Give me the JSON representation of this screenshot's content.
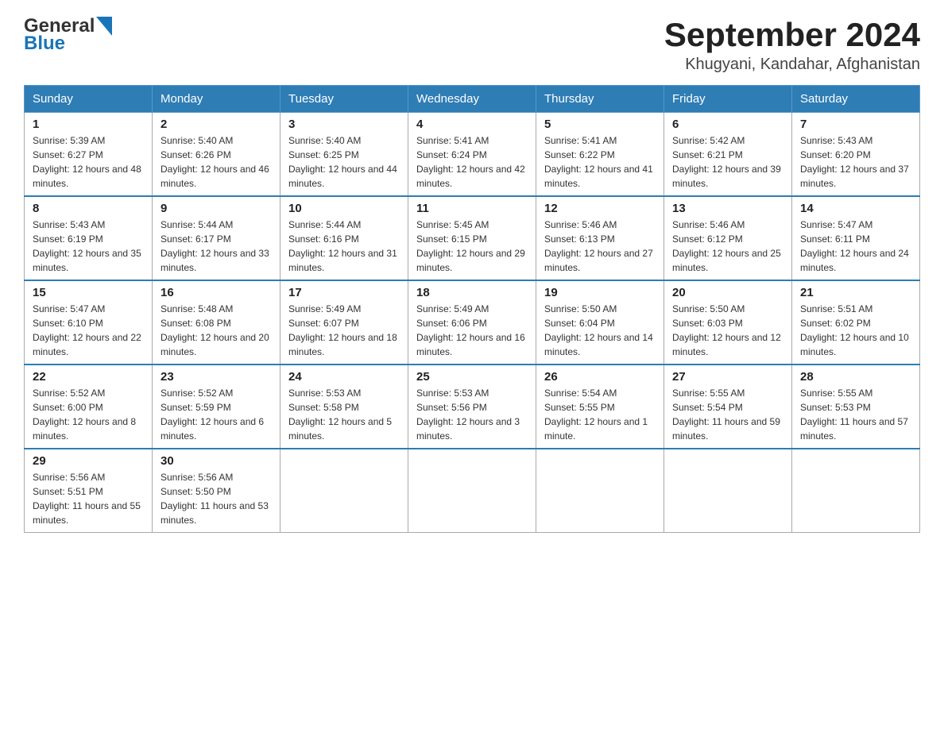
{
  "header": {
    "logo_general": "General",
    "logo_blue": "Blue",
    "title": "September 2024",
    "subtitle": "Khugyani, Kandahar, Afghanistan"
  },
  "columns": [
    "Sunday",
    "Monday",
    "Tuesday",
    "Wednesday",
    "Thursday",
    "Friday",
    "Saturday"
  ],
  "weeks": [
    [
      {
        "day": "1",
        "sunrise": "Sunrise: 5:39 AM",
        "sunset": "Sunset: 6:27 PM",
        "daylight": "Daylight: 12 hours and 48 minutes."
      },
      {
        "day": "2",
        "sunrise": "Sunrise: 5:40 AM",
        "sunset": "Sunset: 6:26 PM",
        "daylight": "Daylight: 12 hours and 46 minutes."
      },
      {
        "day": "3",
        "sunrise": "Sunrise: 5:40 AM",
        "sunset": "Sunset: 6:25 PM",
        "daylight": "Daylight: 12 hours and 44 minutes."
      },
      {
        "day": "4",
        "sunrise": "Sunrise: 5:41 AM",
        "sunset": "Sunset: 6:24 PM",
        "daylight": "Daylight: 12 hours and 42 minutes."
      },
      {
        "day": "5",
        "sunrise": "Sunrise: 5:41 AM",
        "sunset": "Sunset: 6:22 PM",
        "daylight": "Daylight: 12 hours and 41 minutes."
      },
      {
        "day": "6",
        "sunrise": "Sunrise: 5:42 AM",
        "sunset": "Sunset: 6:21 PM",
        "daylight": "Daylight: 12 hours and 39 minutes."
      },
      {
        "day": "7",
        "sunrise": "Sunrise: 5:43 AM",
        "sunset": "Sunset: 6:20 PM",
        "daylight": "Daylight: 12 hours and 37 minutes."
      }
    ],
    [
      {
        "day": "8",
        "sunrise": "Sunrise: 5:43 AM",
        "sunset": "Sunset: 6:19 PM",
        "daylight": "Daylight: 12 hours and 35 minutes."
      },
      {
        "day": "9",
        "sunrise": "Sunrise: 5:44 AM",
        "sunset": "Sunset: 6:17 PM",
        "daylight": "Daylight: 12 hours and 33 minutes."
      },
      {
        "day": "10",
        "sunrise": "Sunrise: 5:44 AM",
        "sunset": "Sunset: 6:16 PM",
        "daylight": "Daylight: 12 hours and 31 minutes."
      },
      {
        "day": "11",
        "sunrise": "Sunrise: 5:45 AM",
        "sunset": "Sunset: 6:15 PM",
        "daylight": "Daylight: 12 hours and 29 minutes."
      },
      {
        "day": "12",
        "sunrise": "Sunrise: 5:46 AM",
        "sunset": "Sunset: 6:13 PM",
        "daylight": "Daylight: 12 hours and 27 minutes."
      },
      {
        "day": "13",
        "sunrise": "Sunrise: 5:46 AM",
        "sunset": "Sunset: 6:12 PM",
        "daylight": "Daylight: 12 hours and 25 minutes."
      },
      {
        "day": "14",
        "sunrise": "Sunrise: 5:47 AM",
        "sunset": "Sunset: 6:11 PM",
        "daylight": "Daylight: 12 hours and 24 minutes."
      }
    ],
    [
      {
        "day": "15",
        "sunrise": "Sunrise: 5:47 AM",
        "sunset": "Sunset: 6:10 PM",
        "daylight": "Daylight: 12 hours and 22 minutes."
      },
      {
        "day": "16",
        "sunrise": "Sunrise: 5:48 AM",
        "sunset": "Sunset: 6:08 PM",
        "daylight": "Daylight: 12 hours and 20 minutes."
      },
      {
        "day": "17",
        "sunrise": "Sunrise: 5:49 AM",
        "sunset": "Sunset: 6:07 PM",
        "daylight": "Daylight: 12 hours and 18 minutes."
      },
      {
        "day": "18",
        "sunrise": "Sunrise: 5:49 AM",
        "sunset": "Sunset: 6:06 PM",
        "daylight": "Daylight: 12 hours and 16 minutes."
      },
      {
        "day": "19",
        "sunrise": "Sunrise: 5:50 AM",
        "sunset": "Sunset: 6:04 PM",
        "daylight": "Daylight: 12 hours and 14 minutes."
      },
      {
        "day": "20",
        "sunrise": "Sunrise: 5:50 AM",
        "sunset": "Sunset: 6:03 PM",
        "daylight": "Daylight: 12 hours and 12 minutes."
      },
      {
        "day": "21",
        "sunrise": "Sunrise: 5:51 AM",
        "sunset": "Sunset: 6:02 PM",
        "daylight": "Daylight: 12 hours and 10 minutes."
      }
    ],
    [
      {
        "day": "22",
        "sunrise": "Sunrise: 5:52 AM",
        "sunset": "Sunset: 6:00 PM",
        "daylight": "Daylight: 12 hours and 8 minutes."
      },
      {
        "day": "23",
        "sunrise": "Sunrise: 5:52 AM",
        "sunset": "Sunset: 5:59 PM",
        "daylight": "Daylight: 12 hours and 6 minutes."
      },
      {
        "day": "24",
        "sunrise": "Sunrise: 5:53 AM",
        "sunset": "Sunset: 5:58 PM",
        "daylight": "Daylight: 12 hours and 5 minutes."
      },
      {
        "day": "25",
        "sunrise": "Sunrise: 5:53 AM",
        "sunset": "Sunset: 5:56 PM",
        "daylight": "Daylight: 12 hours and 3 minutes."
      },
      {
        "day": "26",
        "sunrise": "Sunrise: 5:54 AM",
        "sunset": "Sunset: 5:55 PM",
        "daylight": "Daylight: 12 hours and 1 minute."
      },
      {
        "day": "27",
        "sunrise": "Sunrise: 5:55 AM",
        "sunset": "Sunset: 5:54 PM",
        "daylight": "Daylight: 11 hours and 59 minutes."
      },
      {
        "day": "28",
        "sunrise": "Sunrise: 5:55 AM",
        "sunset": "Sunset: 5:53 PM",
        "daylight": "Daylight: 11 hours and 57 minutes."
      }
    ],
    [
      {
        "day": "29",
        "sunrise": "Sunrise: 5:56 AM",
        "sunset": "Sunset: 5:51 PM",
        "daylight": "Daylight: 11 hours and 55 minutes."
      },
      {
        "day": "30",
        "sunrise": "Sunrise: 5:56 AM",
        "sunset": "Sunset: 5:50 PM",
        "daylight": "Daylight: 11 hours and 53 minutes."
      },
      null,
      null,
      null,
      null,
      null
    ]
  ]
}
